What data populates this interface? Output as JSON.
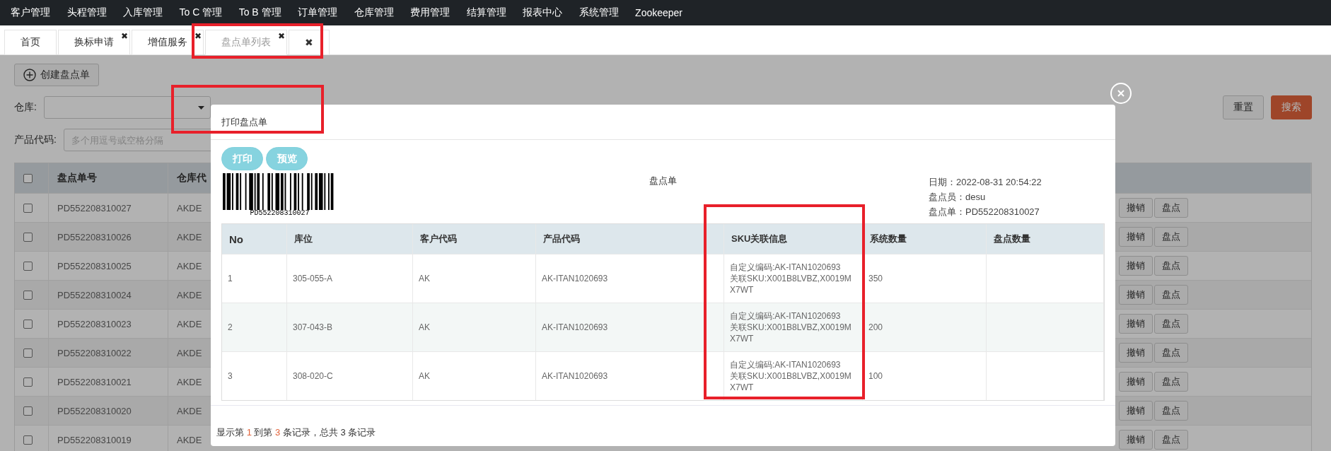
{
  "nav": [
    "客户管理",
    "头程管理",
    "入库管理",
    "To C 管理",
    "To B 管理",
    "订单管理",
    "仓库管理",
    "费用管理",
    "结算管理",
    "报表中心",
    "系统管理",
    "Zookeeper"
  ],
  "tabs": [
    {
      "label": "首页",
      "selected": false
    },
    {
      "label": "换标申请",
      "close": "✖",
      "selected": false
    },
    {
      "label": "增值服务",
      "close": "✖",
      "selected": false
    },
    {
      "label": "盘点单列表",
      "close": "✖",
      "selected": true
    },
    {
      "label": "✖",
      "selected": false
    }
  ],
  "page": {
    "create_button": "创建盘点单",
    "warehouse_label": "仓库:",
    "product_code_label": "产品代码:",
    "product_code_placeholder": "多个用逗号或空格分隔",
    "reset_button": "重置",
    "search_button": "搜索",
    "table": {
      "header_checked": false,
      "columns": [
        "盘点单号",
        "仓库代"
      ],
      "rows": [
        {
          "checked": false,
          "order_no": "PD552208310027",
          "warehouse": "AKDE",
          "actions": [
            "撤销",
            "盘点"
          ]
        },
        {
          "checked": false,
          "order_no": "PD552208310026",
          "warehouse": "AKDE",
          "actions": [
            "撤销",
            "盘点"
          ]
        },
        {
          "checked": false,
          "order_no": "PD552208310025",
          "warehouse": "AKDE",
          "actions": [
            "撤销",
            "盘点"
          ]
        },
        {
          "checked": false,
          "order_no": "PD552208310024",
          "warehouse": "AKDE",
          "actions": [
            "撤销",
            "盘点"
          ]
        },
        {
          "checked": false,
          "order_no": "PD552208310023",
          "warehouse": "AKDE",
          "actions": [
            "撤销",
            "盘点"
          ]
        },
        {
          "checked": false,
          "order_no": "PD552208310022",
          "warehouse": "AKDE",
          "actions": [
            "撤销",
            "盘点"
          ]
        },
        {
          "checked": false,
          "order_no": "PD552208310021",
          "warehouse": "AKDE",
          "actions": [
            "撤销",
            "盘点"
          ]
        },
        {
          "checked": false,
          "order_no": "PD552208310020",
          "warehouse": "AKDE",
          "actions": [
            "撤销",
            "盘点"
          ]
        },
        {
          "checked": false,
          "order_no": "PD552208310019",
          "warehouse": "AKDE",
          "actions": [
            "撤销",
            "盘点"
          ]
        }
      ]
    }
  },
  "modal": {
    "title": "打印盘点单",
    "buttons": [
      "打印",
      "预览"
    ],
    "barcode_text": "PD552208310027",
    "document_title": "盘点单",
    "info": [
      "日期：2022-08-31 20:54:22",
      "盘点员：desu",
      "盘点单：PD552208310027"
    ],
    "columns": [
      "No",
      "库位",
      "客户代码",
      "产品代码",
      "SKU关联信息",
      "系统数量",
      "盘点数量"
    ],
    "rows": [
      {
        "no": "1",
        "location": "305-055-A",
        "customer": "AK",
        "product": "AK-ITAN1020693",
        "sku_info": [
          "自定义编码:AK-ITAN1020693",
          "关联SKU:X001B8LVBZ,X0019MX7WT"
        ],
        "system_qty": "350"
      },
      {
        "no": "2",
        "location": "307-043-B",
        "customer": "AK",
        "product": "AK-ITAN1020693",
        "sku_info": [
          "自定义编码:AK-ITAN1020693",
          "关联SKU:X001B8LVBZ,X0019MX7WT"
        ],
        "system_qty": "200"
      },
      {
        "no": "3",
        "location": "308-020-C",
        "customer": "AK",
        "product": "AK-ITAN1020693",
        "sku_info": [
          "自定义编码:AK-ITAN1020693",
          "关联SKU:X001B8LVBZ,X0019MX7WT"
        ],
        "system_qty": "100"
      }
    ],
    "pagination": [
      {
        "text": "显示第 ",
        "highlight": false
      },
      {
        "text": "1",
        "highlight": true
      },
      {
        "text": " 到第 ",
        "highlight": false
      },
      {
        "text": "3",
        "highlight": true
      },
      {
        "text": " 条记录，总共 3 条记录",
        "highlight": false
      }
    ]
  }
}
